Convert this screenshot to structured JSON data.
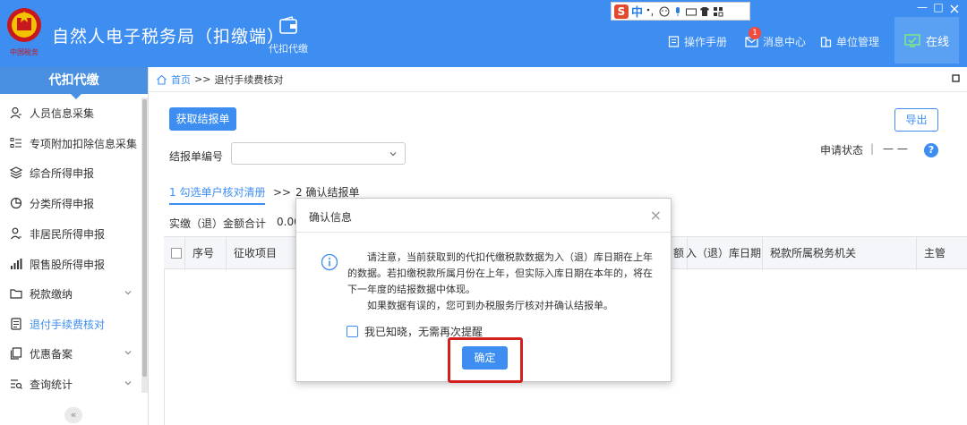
{
  "header": {
    "app_title": "自然人电子税务局（扣缴端）",
    "emblem_text": "中国税务",
    "nav_agent": "代扣代缴",
    "manual": "操作手册",
    "messages": "消息中心",
    "messages_badge": "1",
    "unit_manage": "单位管理",
    "online": "在线",
    "min_label": "—",
    "max_label": "□"
  },
  "ime": {
    "logo": "S",
    "mode": "中"
  },
  "sidebar": {
    "title": "代扣代缴",
    "items": [
      {
        "label": "人员信息采集",
        "icon": "user-icon"
      },
      {
        "label": "专项附加扣除信息采集",
        "icon": "list-icon"
      },
      {
        "label": "综合所得申报",
        "icon": "layers-icon"
      },
      {
        "label": "分类所得申报",
        "icon": "pie-icon"
      },
      {
        "label": "非居民所得申报",
        "icon": "person-icon"
      },
      {
        "label": "限售股所得申报",
        "icon": "bar-icon"
      },
      {
        "label": "税款缴纳",
        "icon": "folder-icon"
      },
      {
        "label": "退付手续费核对",
        "icon": "doc-icon"
      },
      {
        "label": "优惠备案",
        "icon": "copy-icon"
      },
      {
        "label": "查询统计",
        "icon": "search-list-icon"
      }
    ],
    "collapse": "«"
  },
  "breadcrumb": {
    "home": "首页",
    "sep": ">>",
    "current": "退付手续费核对"
  },
  "toolbar": {
    "fetch": "获取结报单",
    "export": "导出"
  },
  "form": {
    "report_no_label": "结报单编号",
    "status_label": "申请状态",
    "status_sep": "|",
    "status_value": "— —",
    "help": "?"
  },
  "steps": {
    "step1": "1 勾选单户核对清册",
    "sep": ">>",
    "step2": "2 确认结报单"
  },
  "summary": {
    "label": "实缴（退）金额合计",
    "value": "0.00"
  },
  "table": {
    "columns": [
      "序号",
      "征收项目",
      "额",
      "入（退）库日期",
      "税款所属税务机关",
      "主管"
    ]
  },
  "dialog": {
    "title": "确认信息",
    "close": "×",
    "message_1": "请注意，当前获取到的代扣代缴税款数据为入（退）库日期在上年的数据。若扣缴税款所属月份在上年，但实际入库日期在本年的，将在下一年度的结报数据中体现。",
    "message_2": "如果数据有误的，您可到办税服务厅核对并确认结报单。",
    "checkbox": "我已知晓，无需再次提醒",
    "ok": "确定"
  },
  "colors": {
    "primary": "#3d8ef0",
    "highlight": "#d21f1f"
  }
}
